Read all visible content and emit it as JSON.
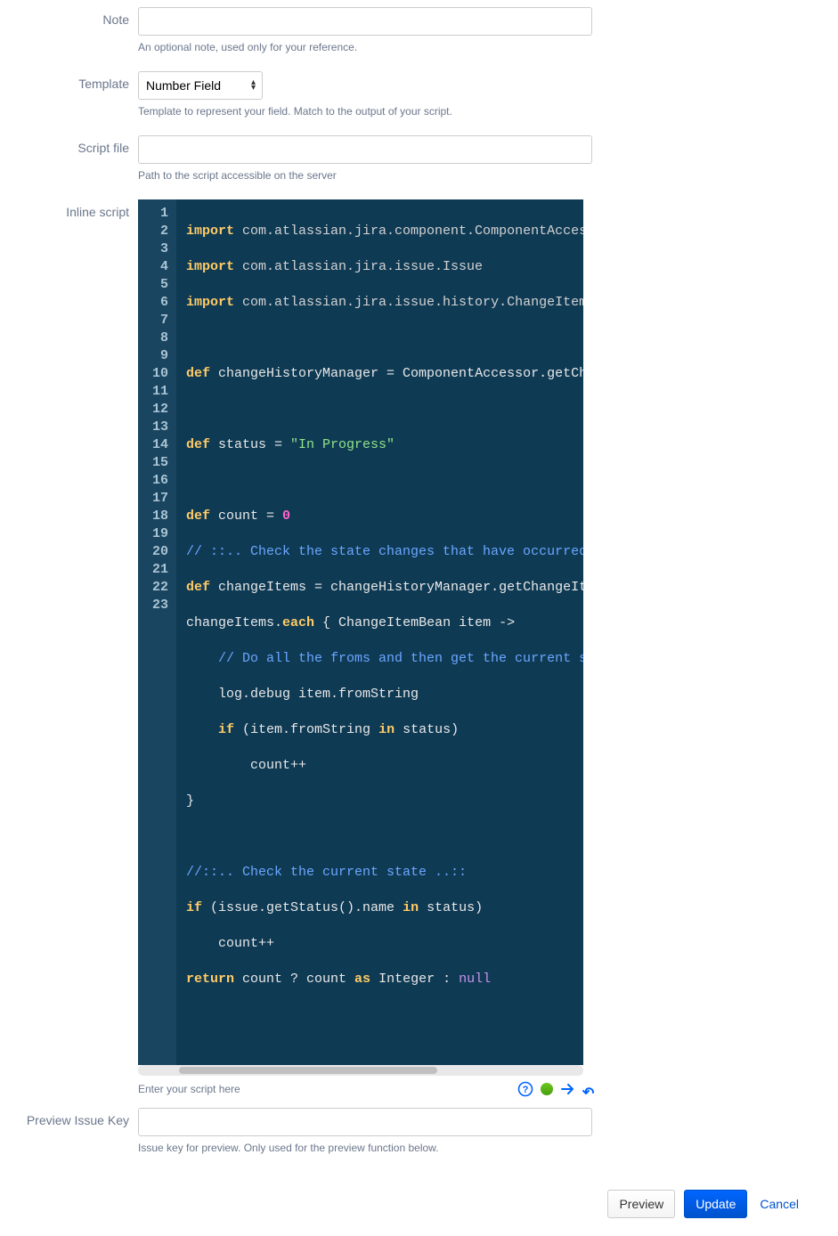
{
  "fields": {
    "note": {
      "label": "Note",
      "value": "",
      "help": "An optional note, used only for your reference."
    },
    "template": {
      "label": "Template",
      "selected": "Number Field",
      "help": "Template to represent your field. Match to the output of your script."
    },
    "scriptfile": {
      "label": "Script file",
      "value": "",
      "help": "Path to the script accessible on the server"
    },
    "inlinescript": {
      "label": "Inline script",
      "help": "Enter your script here"
    },
    "previewkey": {
      "label": "Preview Issue Key",
      "value": "",
      "help": "Issue key for preview. Only used for the preview function below."
    }
  },
  "code": {
    "lines": 23,
    "l1": {
      "kw": "import",
      "rest": " com.atlassian.jira.component.ComponentAccessor"
    },
    "l2": {
      "kw": "import",
      "rest": " com.atlassian.jira.issue.Issue"
    },
    "l3": {
      "kw": "import",
      "rest": " com.atlassian.jira.issue.history.ChangeItemBea"
    },
    "l5a": "def",
    "l5b": " changeHistoryManager = ComponentAccessor.getChang",
    "l7a": "def",
    "l7b": " status = ",
    "l7c": "\"In Progress\"",
    "l9a": "def",
    "l9b": " count = ",
    "l9c": "0",
    "l10": "// ::.. Check the state changes that have occurred ..",
    "l11a": "def",
    "l11b": " changeItems = changeHistoryManager.getChangeItems",
    "l12a": "changeItems.",
    "l12b": "each",
    "l12c": " { ChangeItemBean item ->",
    "l13": "    // Do all the froms and then get the current sta",
    "l14": "    log.debug item.fromString",
    "l15a": "    ",
    "l15b": "if",
    "l15c": " (item.fromString ",
    "l15d": "in",
    "l15e": " status)",
    "l16": "        count++",
    "l17": "}",
    "l19": "//::.. Check the current state ..::",
    "l20a": "if",
    "l20b": " (issue.getStatus().name ",
    "l20c": "in",
    "l20d": " status)",
    "l21": "    count++",
    "l22a": "return",
    "l22b": " count ? count ",
    "l22c": "as",
    "l22d": " Integer : ",
    "l22e": "null"
  },
  "buttons": {
    "preview": "Preview",
    "update": "Update",
    "cancel": "Cancel"
  },
  "icons": {
    "help": "help-circle-icon",
    "status": "status-ok-icon",
    "run": "arrow-right-icon",
    "return": "undo-arrow-icon"
  }
}
